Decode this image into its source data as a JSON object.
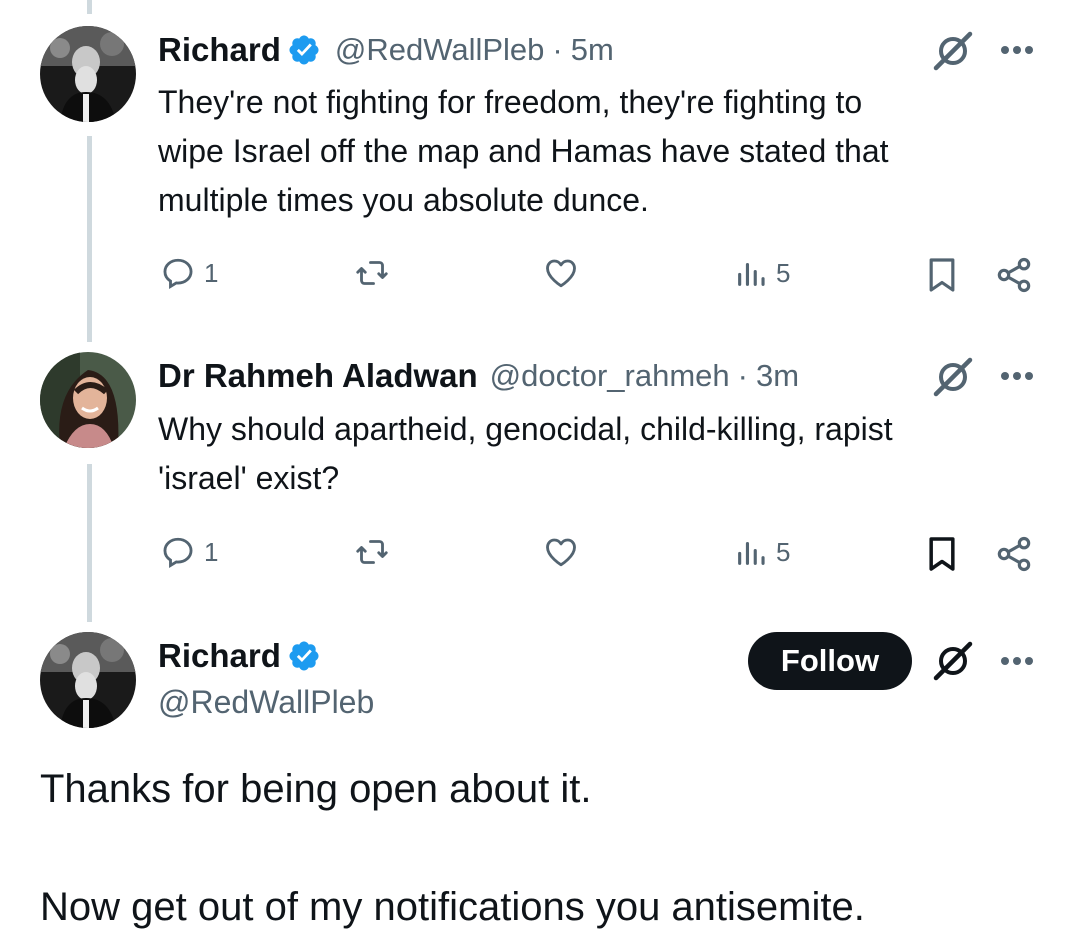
{
  "tweets": [
    {
      "name": "Richard",
      "handle": "@RedWallPleb",
      "separator": "·",
      "time": "5m",
      "text_lines": [
        "They're not fighting for freedom, they're fighting to",
        "wipe Israel off the map and Hamas have stated that",
        "multiple times you absolute dunce."
      ],
      "replies": "1",
      "views": "5"
    },
    {
      "name": "Dr Rahmeh Aladwan",
      "handle": "@doctor_rahmeh",
      "separator": "·",
      "time": "3m",
      "text_lines": [
        "Why should apartheid, genocidal, child-killing, rapist",
        "'israel' exist?"
      ],
      "replies": "1",
      "views": "5"
    }
  ],
  "main_tweet": {
    "name": "Richard",
    "handle": "@RedWallPleb",
    "follow_label": "Follow",
    "text_line_1": "Thanks for being open about it.",
    "text_line_2": "Now get out of my notifications you antisemite."
  },
  "colors": {
    "verified": "#1d9bf0",
    "secondary_text": "#536471",
    "thread_line": "#cfd9de",
    "follow_bg": "#0f1419"
  },
  "icons": [
    "verified-badge-icon",
    "grok-icon",
    "more-icon",
    "reply-icon",
    "retweet-icon",
    "like-icon",
    "views-icon",
    "bookmark-icon",
    "share-icon"
  ]
}
